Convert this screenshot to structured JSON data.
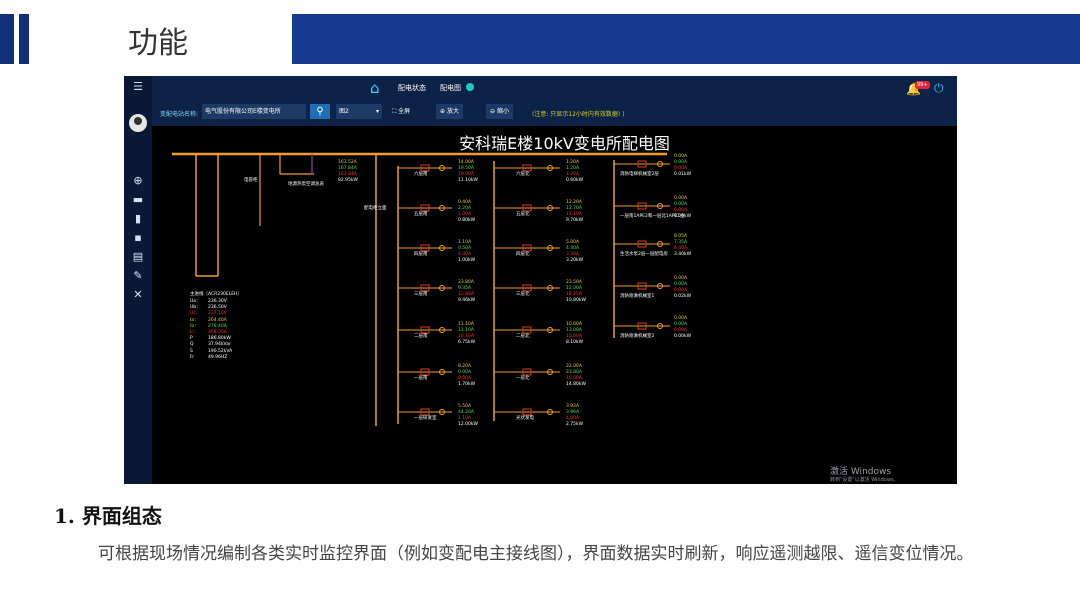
{
  "slide": {
    "title": "功能",
    "section_title": "1. 界面组态",
    "body": "可根据现场情况编制各类实时监控界面（例如变配电主接线图），界面数据实时刷新，响应遥测越限、遥信变位情况。"
  },
  "app": {
    "tabs": [
      {
        "label": "配电状态"
      },
      {
        "label": "配电图"
      }
    ],
    "notification_badge": "99+",
    "toolbar": {
      "station_label": "变配电站名称:",
      "station_value": "电气股份有限公司E楼变电所",
      "select_value": "图2",
      "fullscreen_label": "全屏",
      "zoom_in_label": "放大",
      "zoom_out_label": "缩小",
      "note": "(注意: 只显示12小时内有效数据! )"
    },
    "diagram_title": "安科瑞E楼10kV变电所配电图",
    "watermark": {
      "line1": "激活 Windows",
      "line2": "转到\"设置\"以激活 Windows。"
    },
    "colors": {
      "bus": "#f0a020",
      "breaker": "#e03a2a",
      "cable": "#7c2d8c",
      "value_current": "#e8d21a",
      "value_ok": "#48e05a",
      "value_alarm": "#ff2d2d"
    }
  },
  "diagram": {
    "left_labels": {
      "meter": "电容柜",
      "transformer": "变压器",
      "aux": "地源热泵空调总表"
    },
    "main_meter_title": "主进线（ACR230ELEH）",
    "main_meter": [
      {
        "k": "Ua：",
        "v": "236.30V",
        "c": "w"
      },
      {
        "k": "Ub：",
        "v": "236.50V",
        "c": "w"
      },
      {
        "k": "Uc：",
        "v": "237.10V",
        "c": "r"
      },
      {
        "k": "Ia：",
        "v": "264.40A",
        "c": "y"
      },
      {
        "k": "Ib：",
        "v": "278.40A",
        "c": "g"
      },
      {
        "k": "Ic：",
        "v": "269.20A",
        "c": "r"
      },
      {
        "k": "P",
        "v": "186.80kW",
        "c": "w"
      },
      {
        "k": "Q",
        "v": "37.94kVar",
        "c": "w"
      },
      {
        "k": "S",
        "v": "190.52kVA",
        "c": "w"
      },
      {
        "k": "Fr",
        "v": "49.96HZ",
        "c": "w"
      }
    ],
    "first_feeder": {
      "ia": "163.52A",
      "ib": "167.84A",
      "ic": "163.84A",
      "p": "92.95kW"
    },
    "col1": [
      {
        "name": "六层南",
        "ia": "14.00A",
        "ib": "19.50A",
        "ic": "19.00A",
        "p": "11.10kW"
      },
      {
        "name": "五层南",
        "ia": "0.40A",
        "ib": "2.20A",
        "ic": "1.00A",
        "p": "0.80kW"
      },
      {
        "name": "四层南",
        "ia": "1.10A",
        "ib": "0.50A",
        "ic": "4.40A",
        "p": "1.00kW"
      },
      {
        "name": "三层南",
        "ia": "23.80A",
        "ib": "9.35A",
        "ic": "12.80A",
        "p": "9.46kW"
      },
      {
        "name": "二层南",
        "ia": "11.10A",
        "ib": "11.10A",
        "ic": "10.10A",
        "p": "6.75kW"
      },
      {
        "name": "一层南",
        "ia": "8.20A",
        "ib": "0.00A",
        "ic": "0.00A",
        "p": "1.70kW"
      },
      {
        "name": "一层研发室",
        "ia": "5.50A",
        "ib": "44.20A",
        "ic": "1.10A",
        "p": "12.00kW"
      }
    ],
    "col2": [
      {
        "name": "六层北",
        "ia": "1.20A",
        "ib": "1.20A",
        "ic": "1.20A",
        "p": "0.60kW"
      },
      {
        "name": "五层北",
        "ia": "12.20A",
        "ib": "12.70A",
        "ic": "11.10A",
        "p": "9.70kW"
      },
      {
        "name": "四层北",
        "ia": "5.00A",
        "ib": "4.40A",
        "ic": "3.30A",
        "p": "3.20kW"
      },
      {
        "name": "三层北",
        "ia": "23.50A",
        "ib": "12.00A",
        "ic": "18.25A",
        "p": "10.80kW"
      },
      {
        "name": "二层北",
        "ia": "10.60A",
        "ib": "13.00A",
        "ic": "10.00A",
        "p": "8.10kW"
      },
      {
        "name": "一层北",
        "ia": "22.00A",
        "ib": "23.80A",
        "ic": "10.00A",
        "p": "14.80kW"
      },
      {
        "name": "光伏发电",
        "ia": "3.92A",
        "ib": "3.96A",
        "ic": "4.00A",
        "p": "2.75kW"
      }
    ],
    "col3": [
      {
        "name": "消防电梯机械室2层",
        "ia": "0.00A",
        "ib": "0.00A",
        "ic": "0.00A",
        "p": "0.01kW"
      },
      {
        "name": "一层南1APE2和一层北1APE1主",
        "ia": "0.00A",
        "ib": "0.00A",
        "ic": "0.00A",
        "p": "0.00kW"
      },
      {
        "name": "生活水泵2层一层配电房",
        "ia": "8.05A",
        "ib": "7.35A",
        "ic": "6.40A",
        "p": "3.40kW"
      },
      {
        "name": "消防喷淋机械室1",
        "ia": "0.00A",
        "ib": "0.00A",
        "ic": "0.00A",
        "p": "0.02kW"
      },
      {
        "name": "消防喷淋机械室2",
        "ia": "0.00A",
        "ib": "0.00A",
        "ic": "0.00A",
        "p": "0.00kW"
      }
    ],
    "vertical_label": "配电柜立面"
  }
}
